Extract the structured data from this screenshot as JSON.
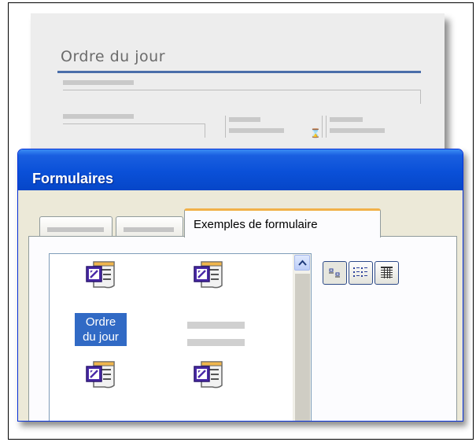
{
  "document": {
    "title": "Ordre du jour"
  },
  "dialog": {
    "title": "Formulaires",
    "tabs": [
      {
        "label": ""
      },
      {
        "label": ""
      },
      {
        "label": "Exemples de formulaire",
        "active": true
      }
    ],
    "templates": [
      {
        "label_line1": "Ordre",
        "label_line2": "du jour",
        "selected": true,
        "icon": "form-template-icon"
      },
      {
        "label_line1": "",
        "label_line2": "",
        "selected": false,
        "icon": "form-template-icon"
      },
      {
        "label_line1": "",
        "label_line2": "",
        "selected": false,
        "icon": "form-template-icon"
      },
      {
        "label_line1": "",
        "label_line2": "",
        "selected": false,
        "icon": "form-template-icon"
      }
    ],
    "view_buttons": [
      {
        "name": "large-icons-view-icon",
        "pressed": true
      },
      {
        "name": "list-view-icon",
        "pressed": false
      },
      {
        "name": "details-view-icon",
        "pressed": false
      }
    ]
  },
  "colors": {
    "titlebar": "#0a50d8",
    "selection": "#316ac5",
    "doc_rule": "#4a6eaa",
    "active_tab_accent": "#f1b14a"
  }
}
